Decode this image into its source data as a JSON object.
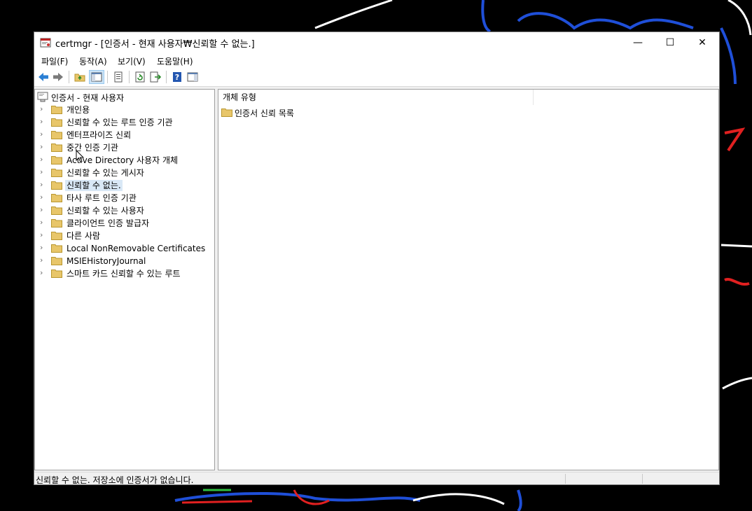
{
  "window": {
    "title": "certmgr - [인증서 - 현재 사용자₩신뢰할 수 없는.]",
    "controls": {
      "minimize": "—",
      "maximize": "☐",
      "close": "✕"
    }
  },
  "menu": [
    {
      "label": "파일(F)"
    },
    {
      "label": "동작(A)"
    },
    {
      "label": "보기(V)"
    },
    {
      "label": "도움말(H)"
    }
  ],
  "toolbar": {
    "buttons": [
      "back-icon",
      "forward-icon",
      "up-folder-icon",
      "show-hide-console-tree-icon",
      "properties-icon",
      "refresh-icon",
      "export-list-icon",
      "help-icon",
      "action-pane-icon"
    ]
  },
  "tree": {
    "root": "인증서 - 현재 사용자",
    "items": [
      {
        "label": "개인용"
      },
      {
        "label": "신뢰할 수 있는 루트 인증 기관"
      },
      {
        "label": "엔터프라이즈 신뢰"
      },
      {
        "label": "중간 인증 기관"
      },
      {
        "label": "Active Directory 사용자 개체"
      },
      {
        "label": "신뢰할 수 있는 게시자"
      },
      {
        "label": "신뢰할 수 없는.",
        "selected": true
      },
      {
        "label": "타사 루트 인증 기관"
      },
      {
        "label": "신뢰할 수 있는 사용자"
      },
      {
        "label": "클라이언트 인증 발급자"
      },
      {
        "label": "다른 사람"
      },
      {
        "label": "Local NonRemovable Certificates"
      },
      {
        "label": "MSIEHistoryJournal"
      },
      {
        "label": "스마트 카드 신뢰할 수 있는 루트"
      }
    ]
  },
  "list": {
    "column": "개체 유형",
    "rows": [
      {
        "label": "인증서 신뢰 목록"
      }
    ]
  },
  "status": {
    "text": "신뢰할 수 없는. 저장소에 인증서가 없습니다."
  },
  "colors": {
    "selection": "#d9e8f6",
    "folder": "#e8c66a",
    "scribble_blue": "#1f4fd8",
    "scribble_red": "#e02020"
  }
}
